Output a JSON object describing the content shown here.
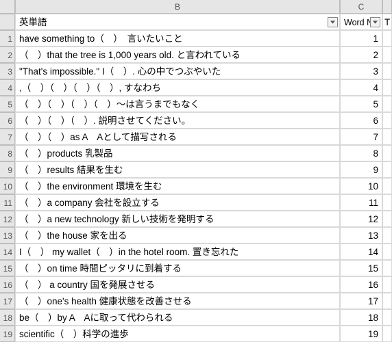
{
  "columns": {
    "b": "B",
    "c": "C",
    "d": ""
  },
  "header": {
    "b": "英単語",
    "c": "Word No",
    "d": "T"
  },
  "rows": [
    {
      "n": "1",
      "b": "have something to（　）　言いたいこと",
      "c": "1"
    },
    {
      "n": "2",
      "b": "（　）that the tree is 1,000 years old. と言われている",
      "c": "2"
    },
    {
      "n": "3",
      "b": "\"That's impossible.\" I（　）. 心の中でつぶやいた",
      "c": "3"
    },
    {
      "n": "4",
      "b": ",（　）（　）（　）（　）, すなわち",
      "c": "4"
    },
    {
      "n": "5",
      "b": "（　）（　）（　）（　）～は言うまでもなく",
      "c": "5"
    },
    {
      "n": "6",
      "b": "（　）（　）（　）. 説明させてください。",
      "c": "6"
    },
    {
      "n": "7",
      "b": "（　）（　）as A　Aとして描写される",
      "c": "7"
    },
    {
      "n": "8",
      "b": "（　）products 乳製品",
      "c": "8"
    },
    {
      "n": "9",
      "b": "（　）results 結果を生む",
      "c": "9"
    },
    {
      "n": "10",
      "b": "（　）the environment 環境を生む",
      "c": "10"
    },
    {
      "n": "11",
      "b": "（　）a company 会社を設立する",
      "c": "11"
    },
    {
      "n": "12",
      "b": "（　）a new technology 新しい技術を発明する",
      "c": "12"
    },
    {
      "n": "13",
      "b": "（　）the house 家を出る",
      "c": "13"
    },
    {
      "n": "14",
      "b": "I（　） my wallet（　）in the hotel room. 置き忘れた",
      "c": "14"
    },
    {
      "n": "15",
      "b": "（　）on time 時間ピッタリに到着する",
      "c": "15"
    },
    {
      "n": "16",
      "b": "（　） a country 国を発展させる",
      "c": "16"
    },
    {
      "n": "17",
      "b": "（　）one's health 健康状態を改善させる",
      "c": "17"
    },
    {
      "n": "18",
      "b": "be（　）by A　Aに取って代わられる",
      "c": "18"
    },
    {
      "n": "19",
      "b": "scientific（　）科学の進歩",
      "c": "19"
    }
  ]
}
